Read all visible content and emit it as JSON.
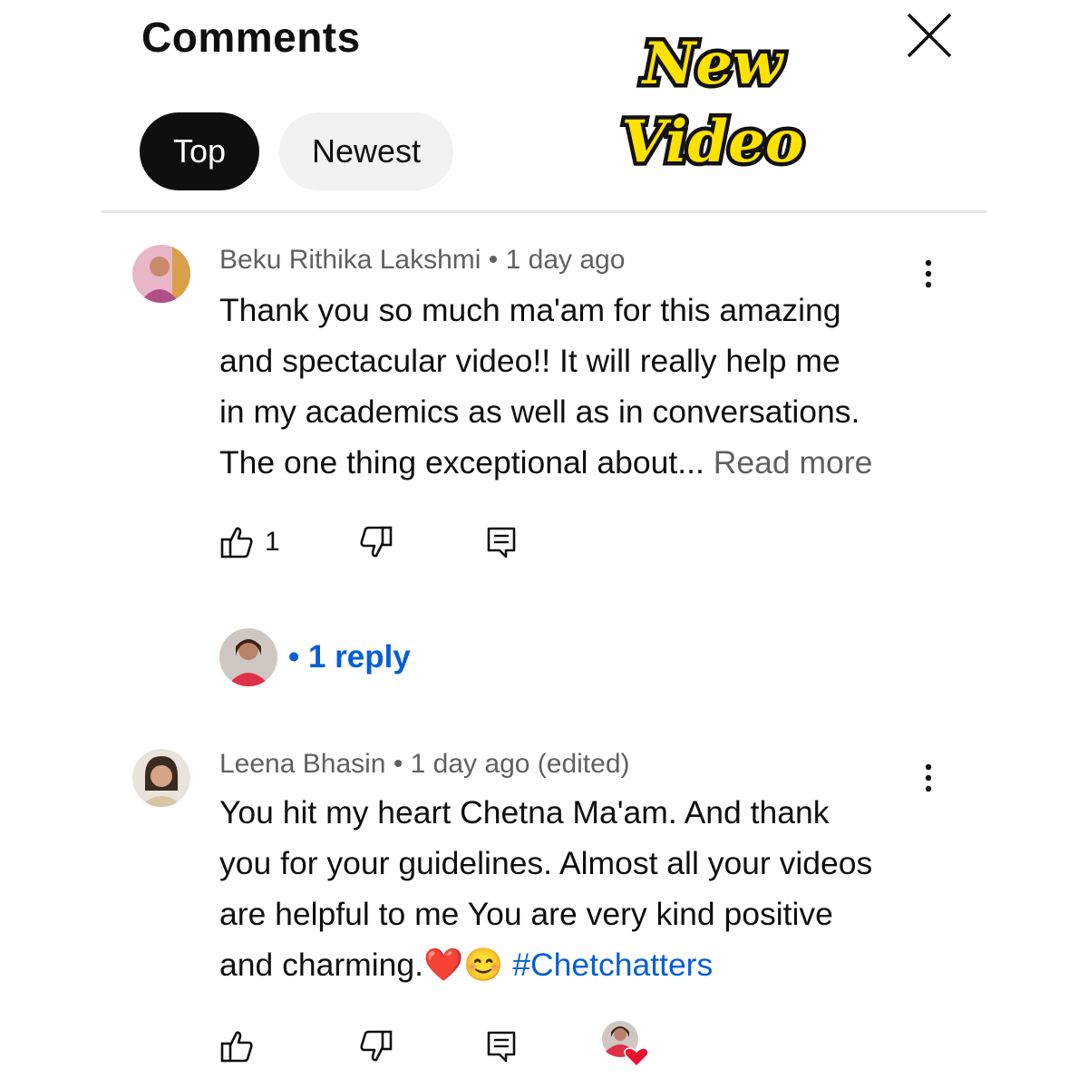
{
  "header": {
    "title": "Comments"
  },
  "badge": {
    "line1": "New",
    "line2": "Video"
  },
  "tabs": [
    {
      "label": "Top",
      "active": true
    },
    {
      "label": "Newest",
      "active": false
    }
  ],
  "comments": [
    {
      "author": "Beku Rithika Lakshmi",
      "time": "1 day ago",
      "meta": "Beku Rithika Lakshmi • 1 day ago",
      "lines": [
        "Thank you so much ma'am for this amazing",
        "and spectacular video!!  It will really help me",
        "in my academics as well as in conversations.",
        "The one thing exceptional about... "
      ],
      "read_more": "Read more",
      "likes": "1",
      "replies": "• 1 reply"
    },
    {
      "author": "Leena Bhasin",
      "time": "1 day ago (edited)",
      "meta": "Leena Bhasin • 1 day ago (edited)",
      "lines": [
        "You hit my heart Chetna Ma'am. And thank",
        "you for your guidelines. Almost all your videos",
        "are helpful to me You are very kind positive",
        "and charming."
      ],
      "emojis": "❤️😊",
      "hashtag": "#Chetchatters"
    }
  ],
  "colors": {
    "link": "#065fd4",
    "meta": "#606060",
    "chip_active": "#0f0f0f",
    "chip_inactive": "#f2f2f2",
    "badge_fill": "#ffe200"
  },
  "icons": [
    "close-icon",
    "like-icon",
    "dislike-icon",
    "reply-icon",
    "more-vert-icon",
    "heart-icon"
  ]
}
